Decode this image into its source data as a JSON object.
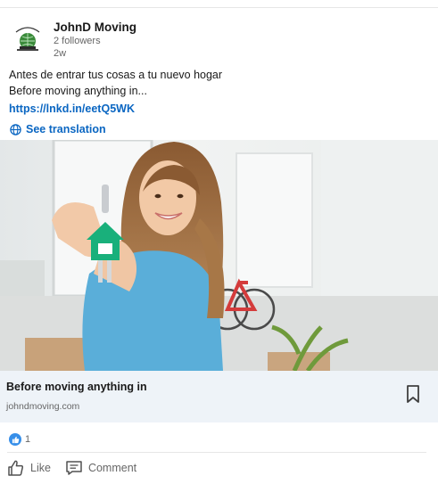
{
  "post": {
    "author": {
      "name": "JohnD Moving",
      "followers": "2 followers",
      "age": "2w"
    },
    "text_lines": [
      "Antes de entrar tus cosas a tu nuevo hogar",
      "Before moving anything in..."
    ],
    "link": "https://lnkd.in/eetQ5WK",
    "see_translation": "See translation",
    "article": {
      "title": "Before moving anything in",
      "domain": "johndmoving.com"
    },
    "reaction_count": "1",
    "actions": {
      "like": "Like",
      "comment": "Comment"
    }
  },
  "colors": {
    "link_blue": "#0a66c2",
    "article_bg": "#eef3f8",
    "reaction_blue": "#378fe9",
    "key_green": "#19b07b"
  }
}
